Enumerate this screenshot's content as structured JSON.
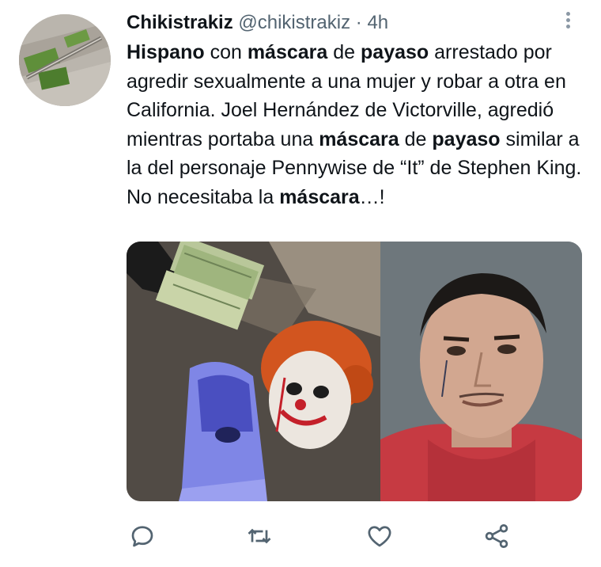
{
  "user": {
    "display_name": "Chikistrakiz",
    "handle": "@chikistrakiz",
    "separator": "·",
    "time": "4h",
    "avatar_icon": "avatar-photo"
  },
  "tweet": {
    "parts": [
      {
        "text": "Hispano",
        "bold": true
      },
      {
        "text": " con ",
        "bold": false
      },
      {
        "text": "máscara",
        "bold": true
      },
      {
        "text": " de ",
        "bold": false
      },
      {
        "text": "payaso",
        "bold": true
      },
      {
        "text": " arrestado por agredir sexualmente a una mujer y robar a otra en California. Joel Hernández de Victorville, agredió  mientras portaba una ",
        "bold": false
      },
      {
        "text": "máscara",
        "bold": true
      },
      {
        "text": " de ",
        "bold": false
      },
      {
        "text": "payaso",
        "bold": true
      },
      {
        "text": " similar a la del personaje Pennywise de “It” de Stephen King. No necesitaba la ",
        "bold": false
      },
      {
        "text": "máscara",
        "bold": true
      },
      {
        "text": "…!",
        "bold": false
      }
    ]
  },
  "media": {
    "left_image": "photo-clown-mask-money-balaclava",
    "right_image": "photo-mugshot-man-red-hoodie"
  },
  "actions": {
    "reply_icon": "reply-icon",
    "retweet_icon": "retweet-icon",
    "like_icon": "heart-icon",
    "share_icon": "share-icon"
  },
  "colors": {
    "text": "#0f1419",
    "secondary": "#536471",
    "icon": "#536471"
  }
}
